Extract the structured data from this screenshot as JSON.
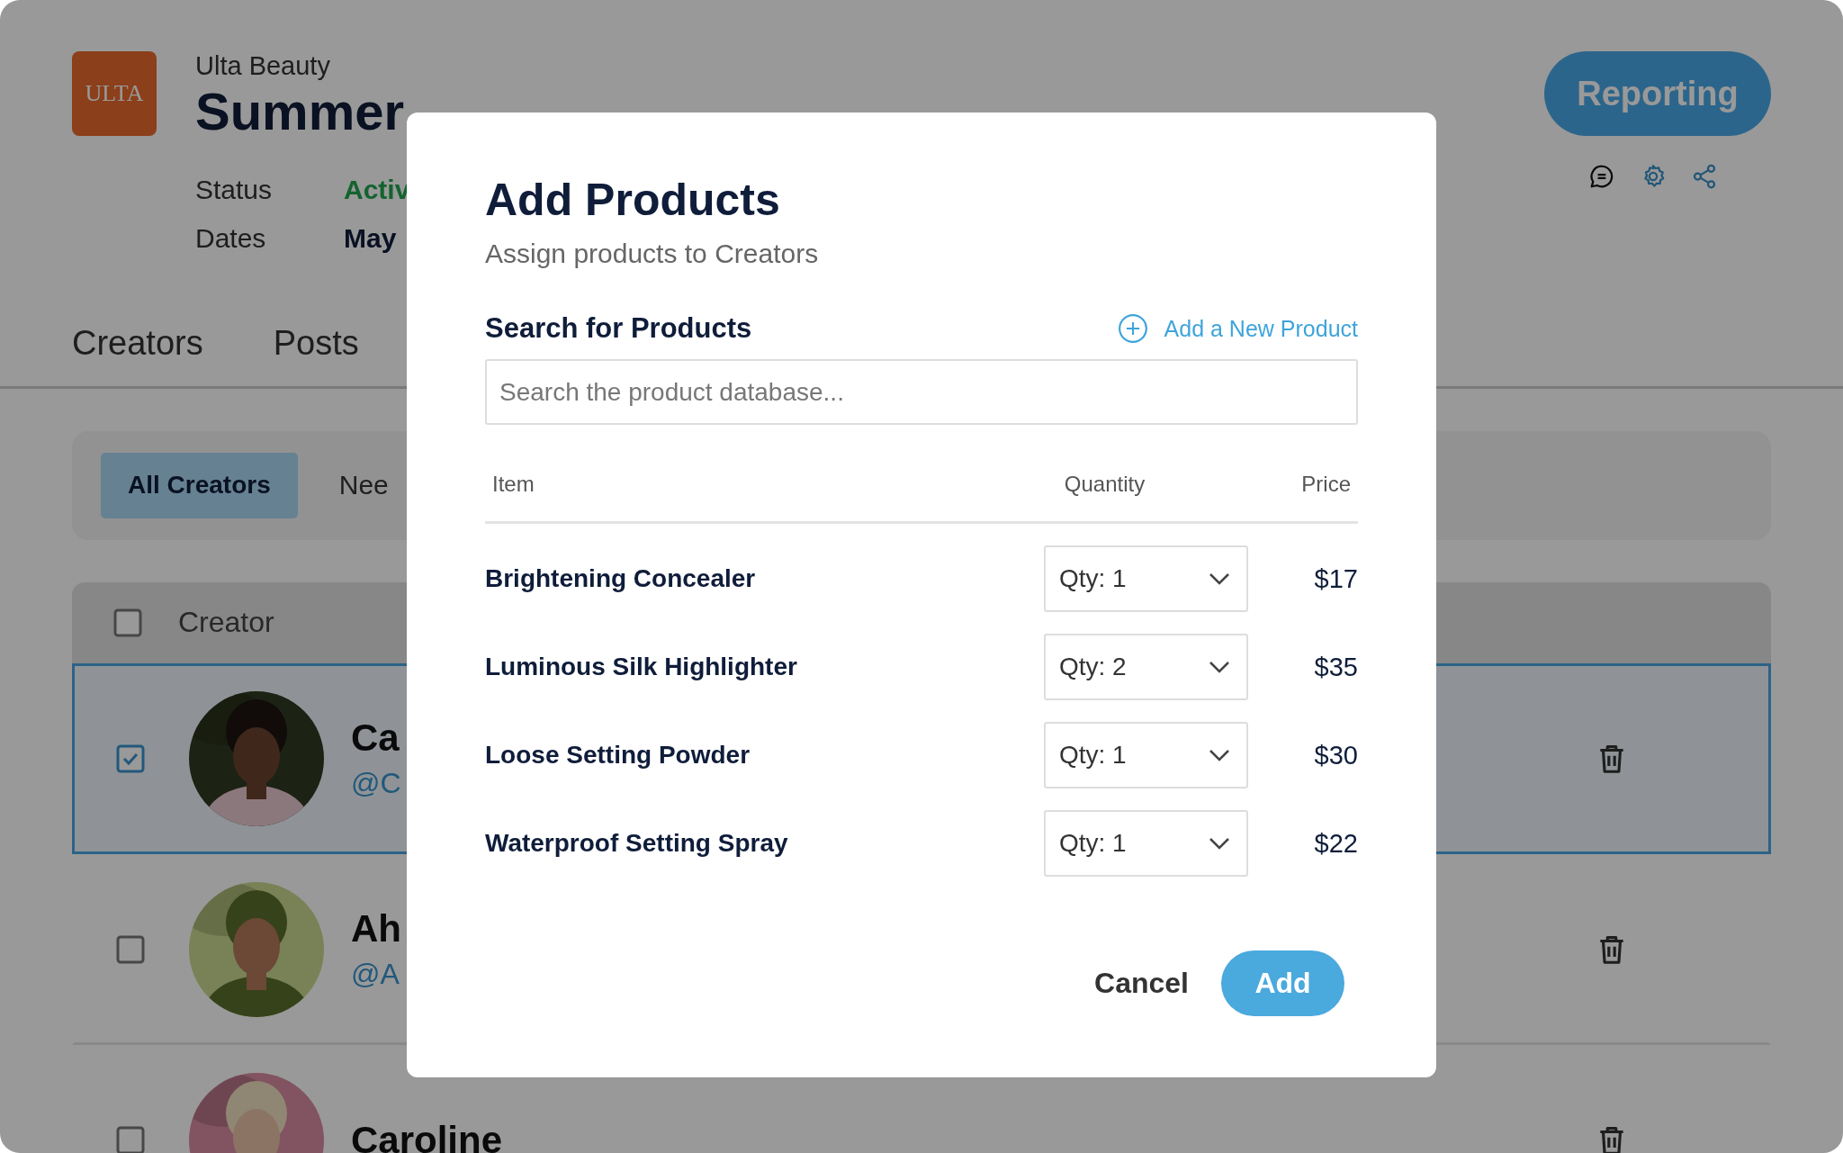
{
  "header": {
    "logo": "ULTA",
    "company": "Ulta Beauty",
    "title": "Summer",
    "details": [
      {
        "label": "Status",
        "value": "Activ",
        "kind": "status"
      },
      {
        "label": "Dates",
        "value": "May",
        "kind": "plain"
      }
    ],
    "reporting_button": "Reporting"
  },
  "tabs": [
    {
      "label": "Creators",
      "selected": false
    },
    {
      "label": "Posts",
      "selected": false
    }
  ],
  "filters": [
    {
      "label": "All Creators",
      "selected": true
    },
    {
      "label": "Nee",
      "selected": false
    }
  ],
  "table": {
    "columns": [
      "Creator"
    ],
    "header_checked": false,
    "rows": [
      {
        "name": "Ca",
        "handle": "@C",
        "checked": true
      },
      {
        "name": "Ah",
        "handle": "@A",
        "checked": false
      },
      {
        "name": "Caroline",
        "checked": false
      }
    ]
  },
  "modal": {
    "title": "Add Products",
    "subtitle": "Assign products to Creators",
    "search_label": "Search for Products",
    "add_new_link": "Add a New Product",
    "search": {
      "placeholder": "Search the product database..."
    },
    "columns": [
      "Item",
      "Quantity",
      "Price"
    ],
    "products": [
      {
        "name": "Brightening Concealer",
        "quantity": "Qty: 1",
        "price": "$17"
      },
      {
        "name": "Luminous Silk Highlighter",
        "quantity": "Qty: 2",
        "price": "$35"
      },
      {
        "name": "Loose Setting Powder",
        "quantity": "Qty: 1",
        "price": "$30"
      },
      {
        "name": "Waterproof Setting Spray",
        "quantity": "Qty: 1",
        "price": "$22"
      }
    ],
    "buttons": [
      {
        "label": "Cancel",
        "kind": "text"
      },
      {
        "label": "Add",
        "kind": "primary"
      }
    ]
  }
}
